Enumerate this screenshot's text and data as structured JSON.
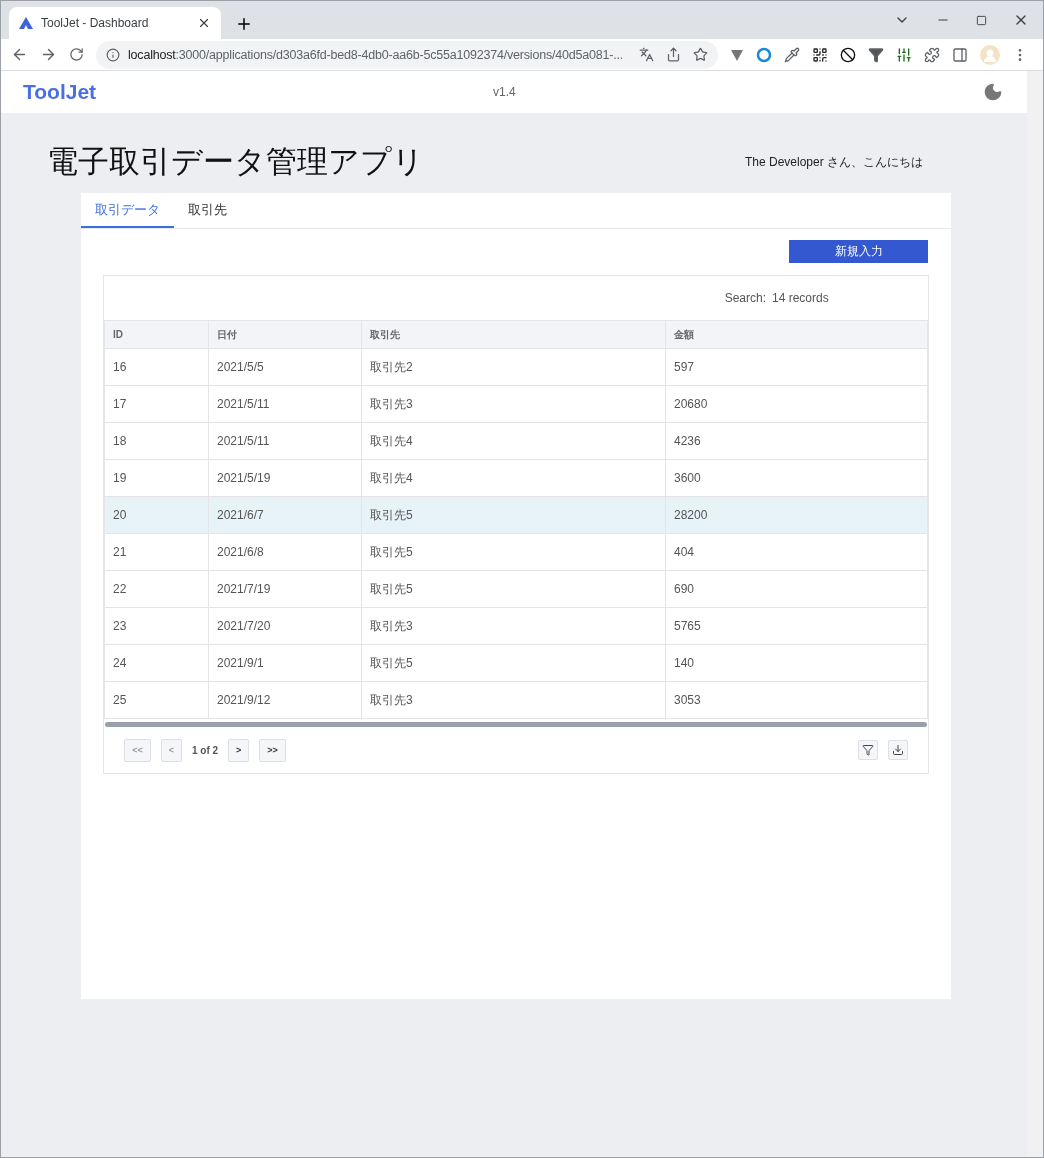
{
  "browser": {
    "tab_title": "ToolJet - Dashboard",
    "url_host": "localhost",
    "url_rest": ":3000/applications/d303a6fd-bed8-4db0-aa6b-5c55a1092374/versions/40d5a081-..."
  },
  "header": {
    "logo": "ToolJet",
    "version": "v1.4"
  },
  "page": {
    "title": "電子取引データ管理アプリ",
    "greeting": "The Developer さん、こんにちは"
  },
  "tabs": [
    {
      "label": "取引データ",
      "selected": true
    },
    {
      "label": "取引先",
      "selected": false
    }
  ],
  "new_button": "新規入力",
  "table": {
    "search_label": "Search:",
    "search_placeholder": "14 records",
    "columns": [
      "ID",
      "日付",
      "取引先",
      "金額"
    ],
    "rows": [
      {
        "cells": [
          "16",
          "2021/5/5",
          "取引先2",
          "597"
        ],
        "selected": false
      },
      {
        "cells": [
          "17",
          "2021/5/11",
          "取引先3",
          "20680"
        ],
        "selected": false
      },
      {
        "cells": [
          "18",
          "2021/5/11",
          "取引先4",
          "4236"
        ],
        "selected": false
      },
      {
        "cells": [
          "19",
          "2021/5/19",
          "取引先4",
          "3600"
        ],
        "selected": false
      },
      {
        "cells": [
          "20",
          "2021/6/7",
          "取引先5",
          "28200"
        ],
        "selected": true
      },
      {
        "cells": [
          "21",
          "2021/6/8",
          "取引先5",
          "404"
        ],
        "selected": false
      },
      {
        "cells": [
          "22",
          "2021/7/19",
          "取引先5",
          "690"
        ],
        "selected": false
      },
      {
        "cells": [
          "23",
          "2021/7/20",
          "取引先3",
          "5765"
        ],
        "selected": false
      },
      {
        "cells": [
          "24",
          "2021/9/1",
          "取引先5",
          "140"
        ],
        "selected": false
      },
      {
        "cells": [
          "25",
          "2021/9/12",
          "取引先3",
          "3053"
        ],
        "selected": false
      }
    ],
    "pagination": {
      "first": {
        "label": "<<",
        "disabled": true
      },
      "prev": {
        "label": "<",
        "disabled": true
      },
      "page": "1 of 2",
      "next": {
        "label": ">",
        "disabled": false
      },
      "last": {
        "label": ">>",
        "disabled": false
      }
    }
  }
}
